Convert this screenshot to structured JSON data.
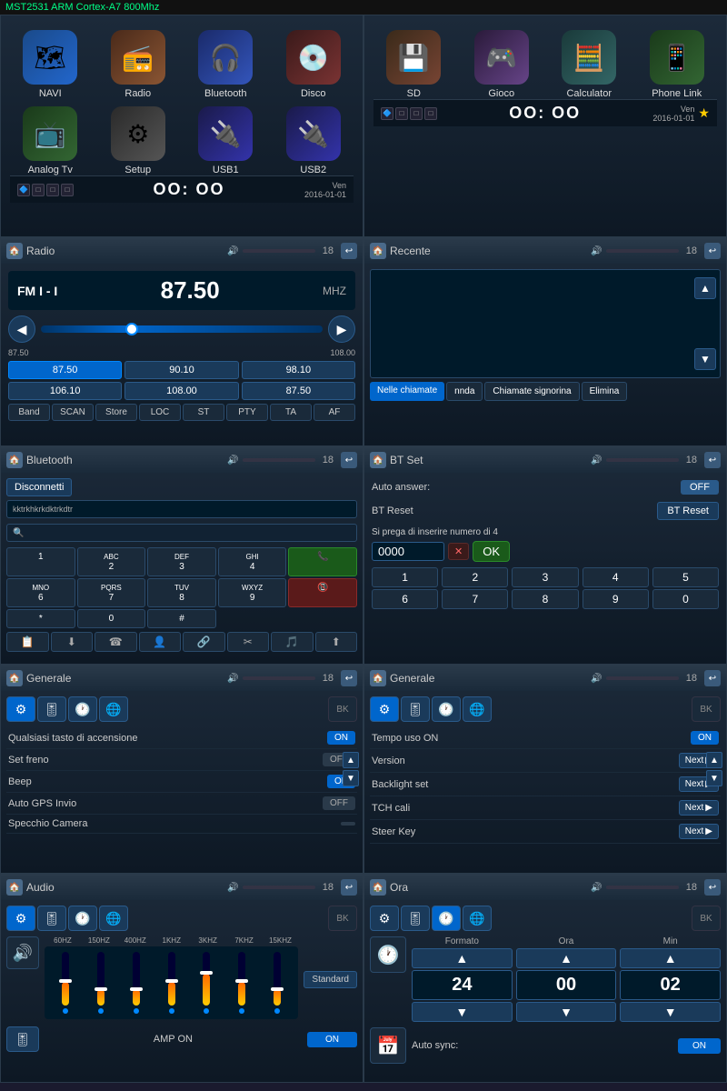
{
  "topbar": {
    "label": "MST2531 ARM Cortex-A7 800Mhz"
  },
  "home1": {
    "icons": [
      {
        "id": "navi",
        "label": "NAVI",
        "icon": "🗺",
        "class": "icon-navi"
      },
      {
        "id": "radio",
        "label": "Radio",
        "icon": "📻",
        "class": "icon-radio"
      },
      {
        "id": "bluetooth",
        "label": "Bluetooth",
        "icon": "🎧",
        "class": "icon-bt"
      },
      {
        "id": "dvd",
        "label": "Disco",
        "icon": "💿",
        "class": "icon-dvd"
      },
      {
        "id": "tv",
        "label": "Analog Tv",
        "icon": "📺",
        "class": "icon-tv"
      },
      {
        "id": "setup",
        "label": "Setup",
        "icon": "⚙",
        "class": "icon-setup"
      },
      {
        "id": "usb1",
        "label": "USB1",
        "icon": "🔌",
        "class": "icon-usb"
      },
      {
        "id": "usb2",
        "label": "USB2",
        "icon": "🔌",
        "class": "icon-usb"
      }
    ],
    "status": {
      "time": "OO: OO",
      "day": "Ven",
      "date": "2016-01-01"
    }
  },
  "home2": {
    "icons": [
      {
        "id": "sd",
        "label": "SD",
        "icon": "💾",
        "class": "icon-sd"
      },
      {
        "id": "gioco",
        "label": "Gioco",
        "icon": "🎮",
        "class": "icon-game"
      },
      {
        "id": "calc",
        "label": "Calculator",
        "icon": "🧮",
        "class": "icon-calc"
      },
      {
        "id": "phonelink",
        "label": "Phone Link",
        "icon": "📱",
        "class": "icon-phone"
      }
    ],
    "status": {
      "time": "OO: OO",
      "day": "Ven",
      "date": "2016-01-01"
    }
  },
  "radio": {
    "title": "Radio",
    "band": "FM I - I",
    "freq": "87.50",
    "unit": "MHZ",
    "range_min": "87.50",
    "range_max": "108.00",
    "presets": [
      "87.50",
      "90.10",
      "98.10",
      "106.10",
      "108.00",
      "87.50"
    ],
    "controls": [
      "Band",
      "SCAN",
      "Store",
      "LOC",
      "ST",
      "PTY",
      "TA",
      "AF"
    ],
    "num": 18
  },
  "recente": {
    "title": "Recente",
    "num": 18,
    "tabs": [
      "Nelle chiamate",
      "nnda",
      "Chiamate signorina",
      "Elimina"
    ]
  },
  "bluetooth": {
    "title": "Bluetooth",
    "num": 18,
    "disconnect_label": "Disconnetti",
    "device_text": "kktrkhkrkdktrkdtr",
    "numpad": [
      "1",
      "2",
      "3",
      "4",
      "",
      "",
      "6",
      "7",
      "8",
      "9",
      "0",
      "#"
    ],
    "actions": [
      "📋",
      "⬇",
      "☎",
      "👤",
      "🔗",
      "✂",
      "🎵",
      "⬆"
    ]
  },
  "btset": {
    "title": "BT Set",
    "num": 18,
    "auto_answer_label": "Auto answer:",
    "auto_answer_value": "OFF",
    "bt_reset_label": "BT Reset",
    "bt_reset_btn": "BT Reset",
    "pin_hint": "Si prega di inserire numero di 4",
    "pin_value": "0000",
    "ok_label": "OK",
    "rows": [
      [
        "1",
        "2",
        "3",
        "4",
        "5"
      ],
      [
        "6",
        "7",
        "8",
        "9",
        "0"
      ]
    ]
  },
  "generale1": {
    "title": "Generale",
    "num": 18,
    "settings": [
      {
        "label": "Qualsiasi tasto di accensione",
        "value": "ON",
        "on": true
      },
      {
        "label": "Set freno",
        "value": "OFF",
        "on": false
      },
      {
        "label": "Beep",
        "value": "ON",
        "on": true
      },
      {
        "label": "Auto GPS Invio",
        "value": "OFF",
        "on": false
      },
      {
        "label": "Specchio Camera",
        "value": "",
        "on": false
      }
    ]
  },
  "generale2": {
    "title": "Generale",
    "num": 18,
    "settings": [
      {
        "label": "Tempo uso ON",
        "value": "ON",
        "type": "toggle",
        "on": true
      },
      {
        "label": "Version",
        "value": "Next",
        "type": "next"
      },
      {
        "label": "Backlight set",
        "value": "Next",
        "type": "next"
      },
      {
        "label": "TCH cali",
        "value": "Next",
        "type": "next"
      },
      {
        "label": "Steer Key",
        "value": "Next",
        "type": "next"
      }
    ]
  },
  "audio": {
    "title": "Audio",
    "num": 18,
    "freqs": [
      "60HZ",
      "150HZ",
      "400HZ",
      "1KHZ",
      "3KHZ",
      "7KHZ",
      "15KHZ"
    ],
    "levels": [
      3,
      2,
      2,
      3,
      4,
      3,
      2
    ],
    "preset": "Standard",
    "amp_label": "AMP ON",
    "amp_value": "ON"
  },
  "ora": {
    "title": "Ora",
    "num": 18,
    "formato_label": "Formato",
    "ora_label": "Ora",
    "min_label": "Min",
    "formato_value": "24",
    "ora_value": "00",
    "min_value": "02",
    "autosync_label": "Auto sync:",
    "autosync_value": "ON"
  },
  "tabs": {
    "gear": "⚙",
    "eq": "🎚",
    "clock": "🕐",
    "globe": "🌐",
    "bk": "BK"
  }
}
